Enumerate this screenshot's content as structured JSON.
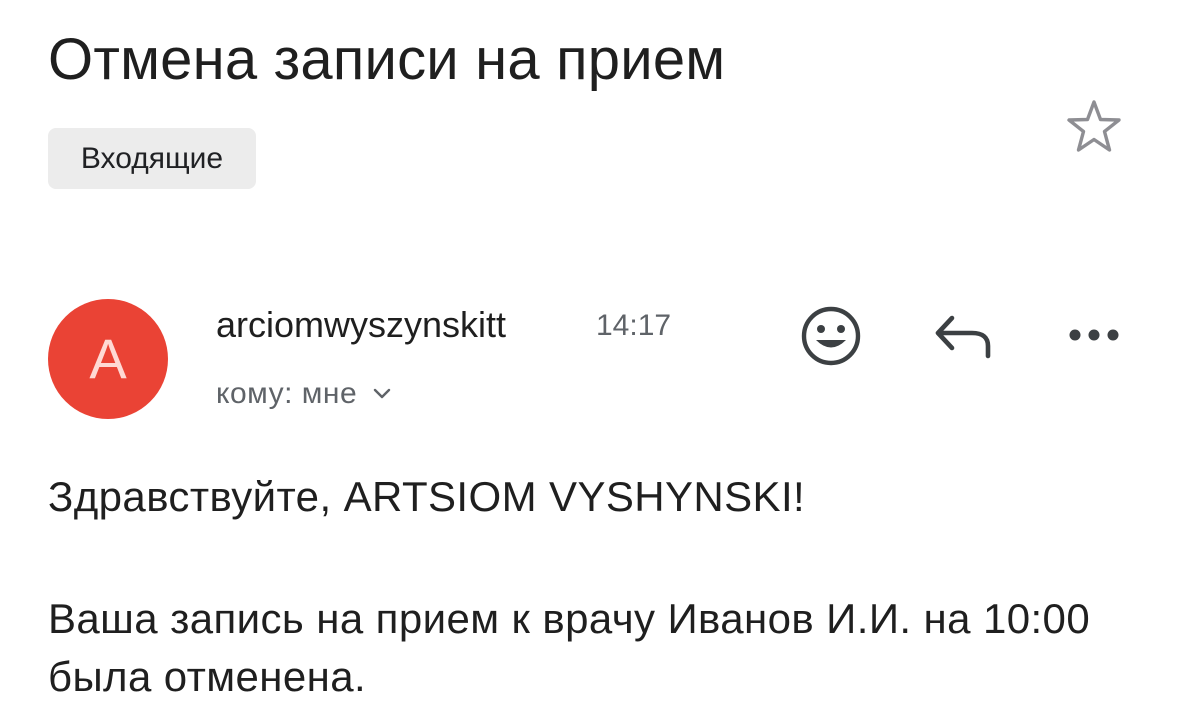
{
  "email": {
    "subject": "Отмена записи на прием",
    "label": "Входящие",
    "sender": {
      "name": "arciomwyszynskitt",
      "avatar_letter": "A",
      "avatar_color": "#ea4335"
    },
    "time": "14:17",
    "recipient": "кому: мне",
    "body": {
      "greeting": "Здравствуйте, ARTSIOM VYSHYNSKI!",
      "message": "Ваша запись на прием к врачу Иванов И.И. на 10:00 была отменена."
    }
  },
  "icons": {
    "star": "star-outline-icon",
    "emoji": "emoji-reaction-icon",
    "reply": "reply-icon",
    "more": "more-options-icon",
    "chevron": "chevron-down-icon"
  }
}
